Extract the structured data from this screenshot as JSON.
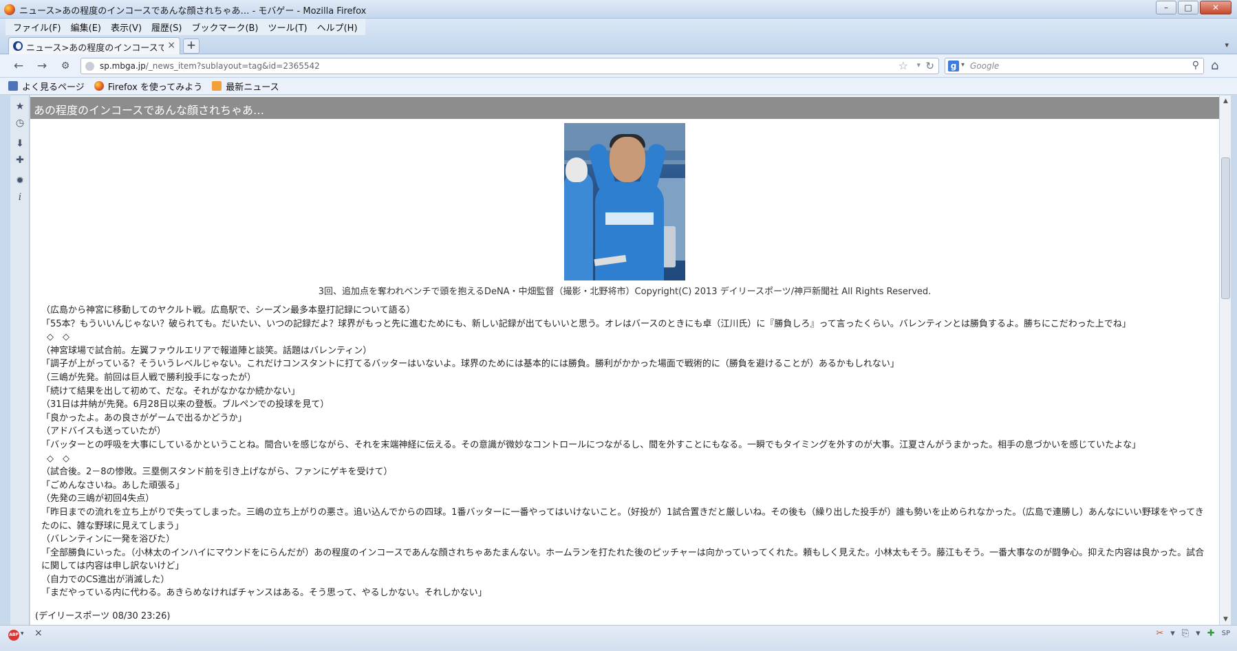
{
  "window": {
    "title": "ニュース>あの程度のインコースであんな顔されちゃあ… - モバゲー - Mozilla Firefox",
    "minimize": "–",
    "maximize": "□",
    "close": "✕"
  },
  "menubar": {
    "items": [
      "ファイル(F)",
      "編集(E)",
      "表示(V)",
      "履歴(S)",
      "ブックマーク(B)",
      "ツール(T)",
      "ヘルプ(H)"
    ]
  },
  "tabs": {
    "active_title": "ニュース>あの程度のインコースで...",
    "close_glyph": "×",
    "new_tab_glyph": "+",
    "list_glyph": "▾"
  },
  "navbar": {
    "back": "←",
    "forward": "→",
    "history": "⚙",
    "url_host": "sp.mbga.jp",
    "url_path": "/_news_item?sublayout=tag&id=2365542",
    "star": "☆",
    "dropdown": "▾",
    "reload": "↻",
    "search_engine": "g",
    "search_engine_drop": "▾",
    "search_placeholder": "Google",
    "search_glyph": "⚲",
    "home": "⌂"
  },
  "bookmarks": {
    "items": [
      "よく見るページ",
      "Firefox を使ってみよう",
      "最新ニュース"
    ]
  },
  "sidebar": {
    "icons": [
      "★",
      "◷",
      "⬇",
      "✚",
      "✹",
      "i"
    ]
  },
  "article": {
    "title": "あの程度のインコースであんな顔されちゃあ…",
    "caption": "3回、追加点を奪われベンチで頭を抱えるDeNA・中畑監督（撮影・北野将市）Copyright(C) 2013 デイリースポーツ/神戸新聞社 All Rights Reserved.",
    "paragraphs": [
      "（広島から神宮に移動してのヤクルト戦。広島駅で、シーズン最多本塁打記録について語る）",
      "「55本？もういいんじゃない？破られても。だいたい、いつの記録だよ？球界がもっと先に進むためにも、新しい記録が出てもいいと思う。オレはバースのときにも卓（江川氏）に『勝負しろ』って言ったくらい。バレンティンとは勝負するよ。勝ちにこだわった上でね」",
      "◇　◇",
      "（神宮球場で試合前。左翼ファウルエリアで報道陣と談笑。話題はバレンティン）",
      "「調子が上がっている？そういうレベルじゃない。これだけコンスタントに打てるバッターはいないよ。球界のためには基本的には勝負。勝利がかかった場面で戦術的に（勝負を避けることが）あるかもしれない」",
      "（三嶋が先発。前回は巨人戦で勝利投手になったが）",
      "「続けて結果を出して初めて、だな。それがなかなか続かない」",
      "（31日は井納が先発。6月28日以来の登板。ブルペンでの投球を見て）",
      "「良かったよ。あの良さがゲームで出るかどうか」",
      "（アドバイスも送っていたが）",
      "「バッターとの呼吸を大事にしているかということね。間合いを感じながら、それを末端神経に伝える。その意識が微妙なコントロールにつながるし、間を外すことにもなる。一瞬でもタイミングを外すのが大事。江夏さんがうまかった。相手の息づかいを感じていたよな」",
      "◇　◇",
      "（試合後。2－8の惨敗。三塁側スタンド前を引き上げながら、ファンにゲキを受けて）",
      "「ごめんなさいね。あした頑張る」",
      "（先発の三嶋が初回4失点）",
      "「昨日までの流れを立ち上がりで失ってしまった。三嶋の立ち上がりの悪さ。追い込んでからの四球。1番バッターに一番やってはいけないこと。（好投が）1試合置きだと厳しいね。その後も（繰り出した投手が）誰も勢いを止められなかった。（広島で連勝し）あんなにいい野球をやってきたのに、雑な野球に見えてしまう」",
      "（バレンティンに一発を浴びた）",
      "「全部勝負にいった。（小林太のインハイにマウンドをにらんだが）あの程度のインコースであんな顔されちゃあたまんない。ホームランを打たれた後のピッチャーは向かっていってくれた。頼もしく見えた。小林太もそう。藤江もそう。一番大事なのが闘争心。抑えた内容は良かった。試合に関しては内容は申し訳ないけど」",
      "（自力でのCS進出が消滅した）",
      "「まだやっている内に代わる。あきらめなければチャンスはある。そう思って、やるしかない。それしかない」"
    ],
    "source": "(デイリースポーツ 08/30 23:26)"
  },
  "scrollbar": {
    "up": "▲",
    "down": "▼"
  },
  "statusbar": {
    "abp_label": "ABP",
    "abp_drop": "▾",
    "close_glyph": "×",
    "addons": [
      "✂",
      "▾",
      "⎘",
      "▾",
      "✚",
      "SP"
    ]
  }
}
